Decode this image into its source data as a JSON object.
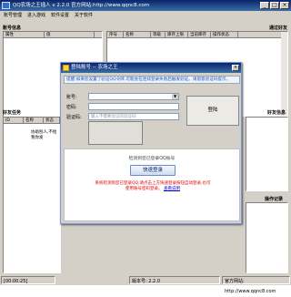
{
  "window": {
    "title": "QQ农场之王插人 v 2.2.0  官方网站:http://www.qqnc8.com"
  },
  "menu": [
    "账号管理",
    "进入游戏",
    "软件设置",
    "关于软件"
  ],
  "panels": {
    "accounts_title": "账号信息",
    "accounts_cols": [
      "属性",
      "值"
    ],
    "friends_title": "通过好友",
    "friends_cols": [
      "序号",
      "名称",
      "等级",
      "库存上限",
      "当前库存",
      "操作状态"
    ],
    "tasks_title": "好友任务",
    "tasks_cols": [
      "ID",
      "名称",
      "状态"
    ],
    "tasks_text": "协助别人,不给我你发",
    "options_title": "好友信息",
    "log_title": "操作记录"
  },
  "status": {
    "time": "[00:00:25]",
    "version": "版本号: 2.2.0",
    "site": "官方网站: http://www.qqnc8.com"
  },
  "dialog": {
    "title": "登陆账号 -- 农场之王",
    "notice": "提醒:如果您设置了验证QQ令牌,可能会在连续登录失败后触发验证。请留意验证码提示。",
    "account_label": "账号:",
    "password_label": "密码:",
    "captcha_label": "验证码:",
    "captcha_placeholder": "输入不需要验证的验证码",
    "login_button": "登陆",
    "qq_hint": "检测到您已登录QQ账号",
    "quick_login": "快速登录",
    "warning": "系统检测到您已登录QQ,请点击上方快速登录按钮自动登录,也可使用账号密码登录。",
    "warning_link": "查看说明"
  }
}
